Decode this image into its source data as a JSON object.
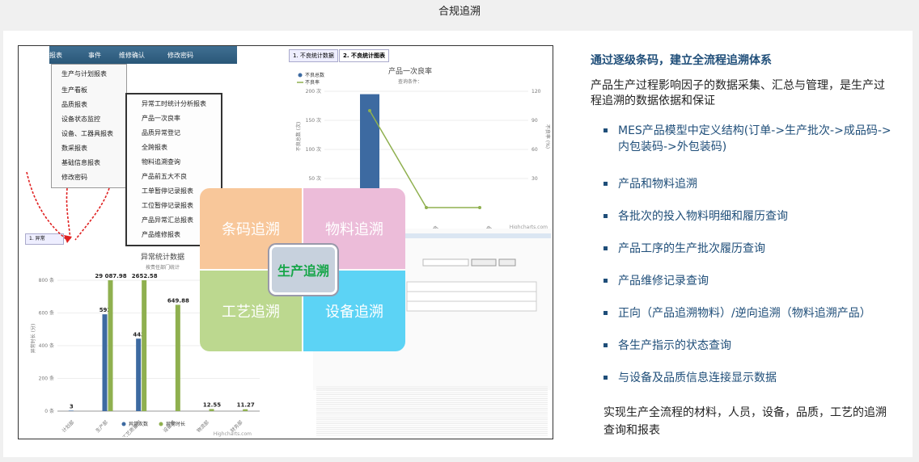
{
  "page_title": "合规追溯",
  "screenshot": {
    "menubar": [
      "报表",
      "事件",
      "维修确认",
      "修改密码"
    ],
    "dropdown": [
      "生产与计划报表",
      "生产看板",
      "品质报表",
      "设备状态监控",
      "设备、工器具报表",
      "数采报表",
      "基础信息报表",
      "修改密码"
    ],
    "submenu": [
      "异常工时统计分析报表",
      "产品一次良率",
      "品质异常登记",
      "全跨报表",
      "物料追溯查询",
      "产品前五大不良",
      "工单暂停记录报表",
      "工位暂停记录报表",
      "产品异常汇总报表",
      "产品维修报表"
    ],
    "tabs": [
      "1. 不良统计数据",
      "2. 不良统计图表"
    ],
    "chart1": {
      "title": "产品一次良率",
      "subtitle": "查询条件：",
      "legend": [
        "不良总数",
        "不良率"
      ],
      "y_left_ticks": [
        "200 次",
        "150 次",
        "100 次",
        "50 次"
      ],
      "y_right_ticks": [
        "120",
        "90",
        "60",
        "30"
      ],
      "ylabel_left": "不良总数 (次)",
      "ylabel_right": "不良率 (%)",
      "x_labels": [
        "焊接不良",
        "包装不良"
      ],
      "credit": "Highcharts.com"
    },
    "chart2": {
      "tab": "1. 异常",
      "title": "异常统计数据",
      "subtitle": "按责任部门统计",
      "y_ticks": [
        "800 条",
        "600 条",
        "400 条",
        "200 条",
        "0 条"
      ],
      "ylabel": "异常时长 (分)",
      "legend": [
        "异常次数",
        "异常时长"
      ],
      "credit": "Highcharts.com"
    },
    "quad": {
      "tl": "条码追溯",
      "tr": "物料追溯",
      "bl": "工艺追溯",
      "br": "设备追溯",
      "center": "生产追溯"
    }
  },
  "chart_data": [
    {
      "type": "bar",
      "title": "异常统计数据",
      "subtitle": "按责任部门统计",
      "categories": [
        "计划部",
        "生产部",
        "工艺质量部",
        "设备部",
        "物流部",
        "财务部"
      ],
      "series": [
        {
          "name": "异常次数",
          "values": [
            3,
            592,
            443,
            0,
            0,
            0
          ]
        },
        {
          "name": "异常时长",
          "values": [
            0,
            29087.98,
            2652.58,
            649.88,
            12.55,
            11.27
          ]
        }
      ],
      "data_labels": [
        "3",
        "592",
        "29 087.98",
        "443",
        "2652.58",
        "649.88",
        "12.55",
        "11.27"
      ],
      "ylim": [
        0,
        800
      ],
      "ylabel": "异常时长 (分)",
      "colors": [
        "#3d6aa1",
        "#8fb04f"
      ]
    },
    {
      "type": "bar",
      "title": "产品一次良率",
      "categories": [
        "",
        "焊接不良",
        "包装不良"
      ],
      "series": [
        {
          "name": "不良总数",
          "values": [
            195,
            0,
            0
          ]
        },
        {
          "name": "不良率",
          "values": [
            100,
            0,
            0
          ]
        }
      ],
      "ylim": [
        0,
        200
      ],
      "colors": [
        "#3d6aa1",
        "#8fb04f"
      ]
    }
  ],
  "right": {
    "title": "通过逐级条码，建立全流程追溯体系",
    "intro": "产品生产过程影响因子的数据采集、汇总与管理，是生产过程追溯的数据依据和保证",
    "bullets": [
      "MES产品模型中定义结构(订单->生产批次->成品码->内包装码->外包装码)",
      "产品和物料追溯",
      "各批次的投入物料明细和履历查询",
      "产品工序的生产批次履历查询",
      "产品维修记录查询",
      "正向（产品追溯物料）/逆向追溯（物料追溯产品）",
      "各生产指示的状态查询",
      "与设备及品质信息连接显示数据"
    ],
    "footer": "实现生产全流程的材料，人员，设备，品质，工艺的追溯查询和报表"
  },
  "colors": {
    "accent": "#1f4e79",
    "quad_tl": "#f8c79a",
    "quad_tr": "#ecbcd9",
    "quad_bl": "#bcd88f",
    "quad_br": "#5cd3f5"
  }
}
